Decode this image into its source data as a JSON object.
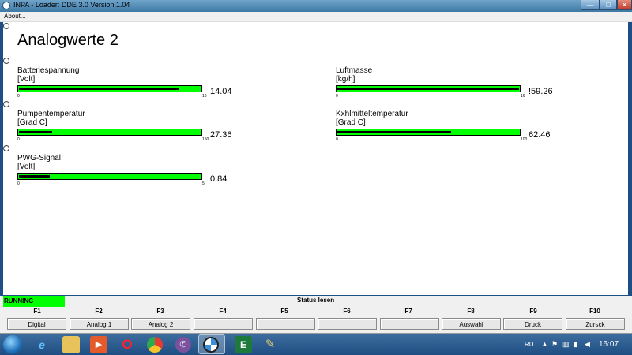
{
  "window": {
    "title": "INPA - Loader:  DDE 3.0 Version 1.04",
    "minimize_glyph": "—",
    "maximize_glyph": "□",
    "close_glyph": "✕"
  },
  "menu": {
    "about_label": "About..."
  },
  "page": {
    "title": "Analogwerte 2"
  },
  "gauges": [
    {
      "label": "Batteriespannung",
      "unit": "[Volt]",
      "min": "0",
      "max": "16",
      "value_text": "14.04",
      "fraction": 0.877
    },
    {
      "label": "Luftmasse",
      "unit": "[kg/h]",
      "min": "0",
      "max": "16",
      "value_text": "!59.26",
      "fraction": 1.0
    },
    {
      "label": "Pumpentemperatur",
      "unit": "[Grad C]",
      "min": "0",
      "max": "150",
      "value_text": "27.36",
      "fraction": 0.182
    },
    {
      "label": "Kхhlmitteltemperatur",
      "unit": "[Grad C]",
      "min": "0",
      "max": "100",
      "value_text": "62.46",
      "fraction": 0.625
    },
    {
      "label": "PWG-Signal",
      "unit": "[Volt]",
      "min": "0",
      "max": "5",
      "value_text": "0.84",
      "fraction": 0.168
    }
  ],
  "status": {
    "running": "RUNNING",
    "text": "Status lesen"
  },
  "fkeys": [
    {
      "key": "F1",
      "label": "Digital"
    },
    {
      "key": "F2",
      "label": "Analog 1"
    },
    {
      "key": "F3",
      "label": "Analog 2"
    },
    {
      "key": "F4",
      "label": ""
    },
    {
      "key": "F5",
      "label": ""
    },
    {
      "key": "F6",
      "label": ""
    },
    {
      "key": "F7",
      "label": ""
    },
    {
      "key": "F8",
      "label": "Auswahl"
    },
    {
      "key": "F9",
      "label": "Druck"
    },
    {
      "key": "F10",
      "label": "Zurьck"
    }
  ],
  "taskbar": {
    "language": "RU",
    "clock": "16:07",
    "icons": [
      "internet-explorer-icon",
      "file-explorer-icon",
      "media-player-icon",
      "opera-icon",
      "chrome-icon",
      "viber-icon",
      "bmw-icon",
      "excel-icon",
      "paint-icon"
    ]
  },
  "colors": {
    "gauge_green": "#00ff00",
    "titlebar": "#3e79a6",
    "taskbar": "#1f4f82"
  }
}
